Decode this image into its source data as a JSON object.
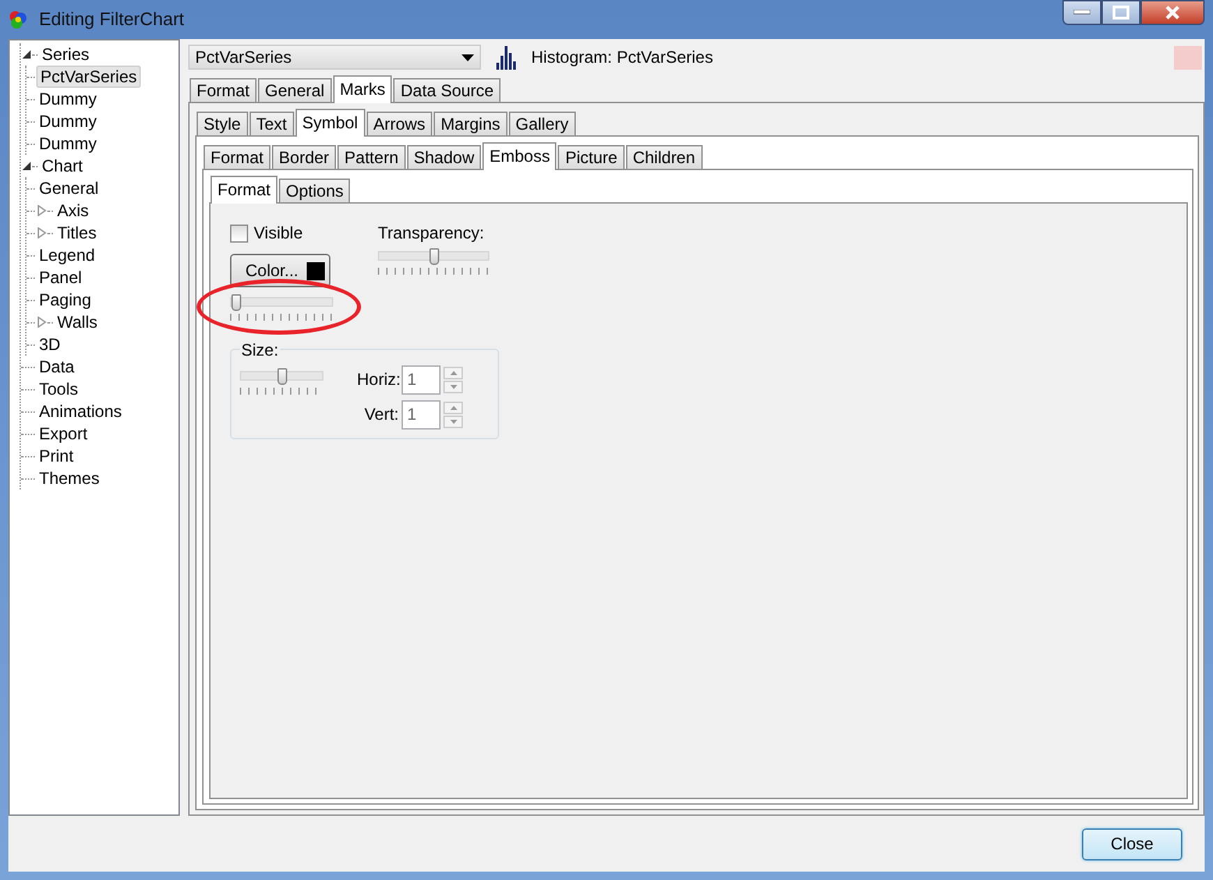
{
  "window": {
    "title": "Editing FilterChart"
  },
  "tree": [
    {
      "label": "Series",
      "expanded": true,
      "selected": false,
      "children": [
        {
          "label": "PctVarSeries",
          "selected": true
        },
        {
          "label": "Dummy",
          "selected": false
        },
        {
          "label": "Dummy",
          "selected": false
        },
        {
          "label": "Dummy",
          "selected": false
        }
      ]
    },
    {
      "label": "Chart",
      "expanded": true,
      "selected": false,
      "children": [
        {
          "label": "General",
          "selected": false
        },
        {
          "label": "Axis",
          "expanded": false,
          "selected": false
        },
        {
          "label": "Titles",
          "expanded": false,
          "selected": false
        },
        {
          "label": "Legend",
          "selected": false
        },
        {
          "label": "Panel",
          "selected": false
        },
        {
          "label": "Paging",
          "selected": false
        },
        {
          "label": "Walls",
          "expanded": false,
          "selected": false
        },
        {
          "label": "3D",
          "selected": false
        }
      ]
    },
    {
      "label": "Data",
      "selected": false
    },
    {
      "label": "Tools",
      "selected": false
    },
    {
      "label": "Animations",
      "selected": false
    },
    {
      "label": "Export",
      "selected": false
    },
    {
      "label": "Print",
      "selected": false
    },
    {
      "label": "Themes",
      "selected": false
    }
  ],
  "series_select": {
    "value": "PctVarSeries"
  },
  "series_type": "Histogram: PctVarSeries",
  "tabs_level1": [
    {
      "label": "Format",
      "selected": false
    },
    {
      "label": "General",
      "selected": false
    },
    {
      "label": "Marks",
      "selected": true
    },
    {
      "label": "Data Source",
      "selected": false
    }
  ],
  "tabs_level2": [
    {
      "label": "Style",
      "selected": false
    },
    {
      "label": "Text",
      "selected": false
    },
    {
      "label": "Symbol",
      "selected": true
    },
    {
      "label": "Arrows",
      "selected": false
    },
    {
      "label": "Margins",
      "selected": false
    },
    {
      "label": "Gallery",
      "selected": false
    }
  ],
  "tabs_level3": [
    {
      "label": "Format",
      "selected": false
    },
    {
      "label": "Border",
      "selected": false
    },
    {
      "label": "Pattern",
      "selected": false
    },
    {
      "label": "Shadow",
      "selected": false
    },
    {
      "label": "Emboss",
      "selected": true
    },
    {
      "label": "Picture",
      "selected": false
    },
    {
      "label": "Children",
      "selected": false
    }
  ],
  "tabs_level4": [
    {
      "label": "Format",
      "selected": true
    },
    {
      "label": "Options",
      "selected": false
    }
  ],
  "emboss_format": {
    "visible": {
      "label": "Visible",
      "checked": false
    },
    "color_button": "Color...",
    "color_slider": {
      "level": 0
    },
    "transparency": {
      "label": "Transparency:",
      "level": 0.5
    },
    "size": {
      "label": "Size:",
      "level": 0.5,
      "horiz": {
        "label": "Horiz:",
        "value": "1"
      },
      "vert": {
        "label": "Vert:",
        "value": "1"
      }
    }
  },
  "buttons": [
    {
      "label": "Close"
    }
  ]
}
